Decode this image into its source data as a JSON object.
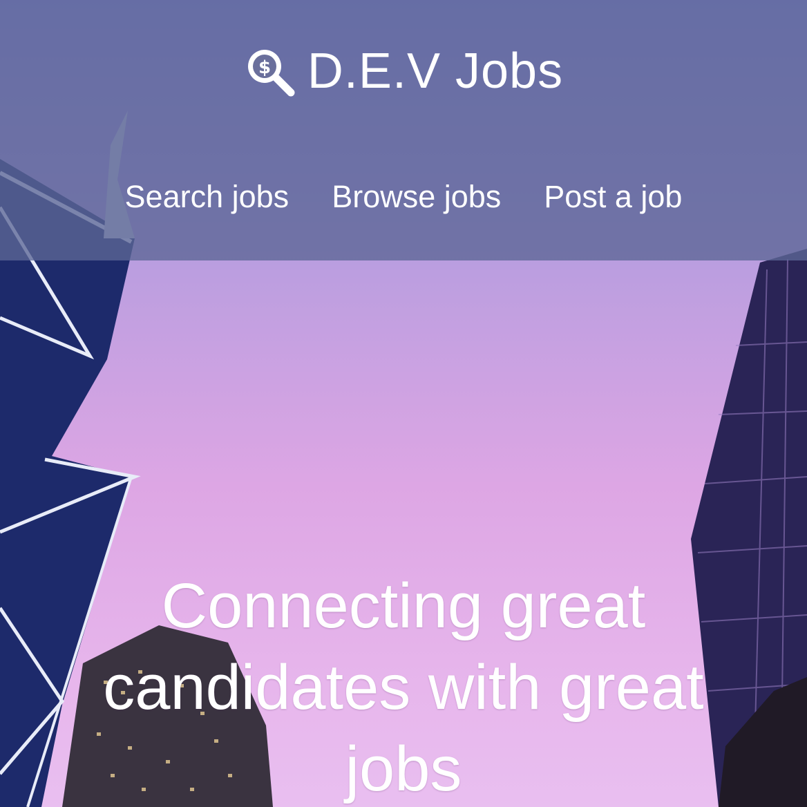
{
  "brand": {
    "name": "D.E.V Jobs",
    "icon": "dollar-search-icon"
  },
  "nav": {
    "items": [
      {
        "label": "Search jobs"
      },
      {
        "label": "Browse jobs"
      },
      {
        "label": "Post a job"
      }
    ]
  },
  "hero": {
    "headline": "Connecting great candidates with great jobs"
  },
  "colors": {
    "header_overlay": "#5c6696",
    "text": "#ffffff",
    "sky_top": "#8a86d8",
    "sky_bottom": "#e9bff0"
  }
}
